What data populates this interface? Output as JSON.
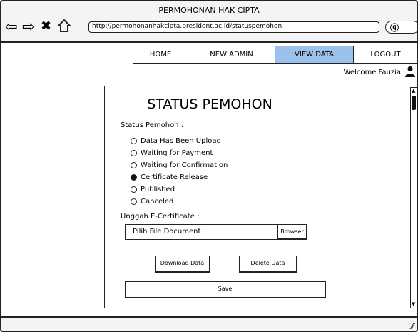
{
  "window": {
    "title": "PERMOHONAN HAK CIPTA"
  },
  "browser": {
    "url": "http://permohonanhakcipta.president.ac.id/statuspemohon",
    "back_icon": "back-arrow-icon",
    "forward_icon": "forward-arrow-icon",
    "close_icon": "close-x-icon",
    "home_icon": "home-icon",
    "search_icon": "search-icon"
  },
  "menu": {
    "items": [
      {
        "label": "HOME"
      },
      {
        "label": "NEW ADMIN"
      },
      {
        "label": "VIEW DATA",
        "active": true
      },
      {
        "label": "LOGOUT"
      }
    ],
    "active_color": "#9ac1ea"
  },
  "user": {
    "welcome": "Welcome Fauzia",
    "icon": "user-icon"
  },
  "form": {
    "title": "STATUS PEMOHON",
    "status_label": "Status Pemohon :",
    "statuses": [
      {
        "label": "Data Has Been Upload",
        "checked": false
      },
      {
        "label": "Waiting for Payment",
        "checked": false
      },
      {
        "label": "Waiting for Confirmation",
        "checked": false
      },
      {
        "label": "Certificate Release",
        "checked": true
      },
      {
        "label": "Published",
        "checked": false
      },
      {
        "label": "Canceled",
        "checked": false
      }
    ],
    "upload_label": "Unggah E-Certificate :",
    "file_placeholder": "Pilih File Document",
    "browse_label": "Browser",
    "download_label": "Download Data",
    "delete_label": "Delete Data",
    "save_label": "Save"
  }
}
